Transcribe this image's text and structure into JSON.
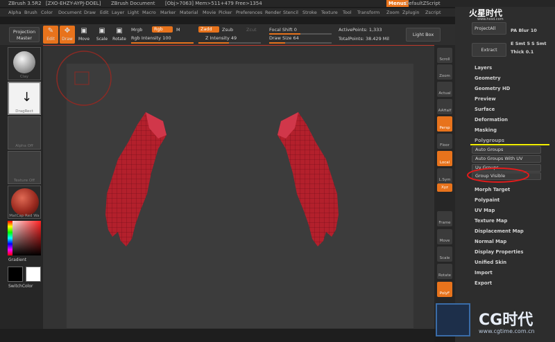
{
  "titlebar": {
    "app": "ZBrush 3.5R2",
    "session": "[ZXO-EHZY-AYPJ-DOEL]",
    "doc": "ZBrush Document",
    "stats": "[Obj>7063] Mem>511+479 Free>1354",
    "menus": "Menus",
    "script": "DefaultZScript"
  },
  "menubar": [
    "Alpha",
    "Brush",
    "Color",
    "Document",
    "Draw",
    "Edit",
    "Layer",
    "Light",
    "Macro",
    "Marker",
    "Material",
    "Movie",
    "Picker",
    "Preferences",
    "Render",
    "Stencil",
    "Stroke",
    "Texture",
    "Tool",
    "Transform",
    "Zoom",
    "Zplugin",
    "Zscript"
  ],
  "toolbar": {
    "projection_master": "Projection Master",
    "edit": "Edit",
    "draw": "Draw",
    "move": "Move",
    "scale": "Scale",
    "rotate": "Rotate",
    "mrgb": "Mrgb",
    "rgb": "Rgb",
    "m": "M",
    "zadd": "Zadd",
    "zsub": "Zsub",
    "zcut": "Zcut",
    "rgb_intensity": "Rgb Intensity 100",
    "z_intensity": "Z Intensity 49",
    "rgb_intensity_value": 1.0,
    "z_intensity_value": 0.49,
    "focal_shift": "Focal Shift 0",
    "draw_size": "Draw Size 64",
    "focal_shift_value": 0.5,
    "draw_size_value": 0.25,
    "active_points": "ActivePoints: 1,333",
    "total_points": "TotalPoints: 38.429 Mil",
    "light_box": "Light Box"
  },
  "leftshelf": {
    "clay": "Clay",
    "dragrect": "DragRect",
    "alpha_off": "Alpha Off",
    "texture_off": "Texture Off",
    "matcap": "MatCap Red Wa",
    "gradient": "Gradient",
    "switchcolor": "SwitchColor"
  },
  "rightshelf": [
    "Scroll",
    "Zoom",
    "Actual",
    "AAHalf",
    "Persp",
    "Floor",
    "Local",
    "L.Sym",
    "Xyz",
    "",
    "Frame",
    "Move",
    "Scale",
    "Rotate",
    "PolyF"
  ],
  "tray": {
    "project_all": "ProjectAll",
    "pa_blur": "PA Blur 10",
    "extract": "Extract",
    "e_smt": "E Smt 5",
    "s_smt": "S Smt",
    "thick": "Thick 0.1",
    "watermark_top": "火星时代",
    "watermark_url": "www.hxsd.com",
    "items": [
      "Layers",
      "Geometry",
      "Geometry HD",
      "Preview",
      "Surface",
      "Deformation",
      "Masking",
      "Polygroups"
    ],
    "polygroup_buttons": [
      "Auto Groups",
      "Auto Groups With UV",
      "Uv Groups",
      "Group Visible"
    ],
    "items2": [
      "Morph Target",
      "Polypaint",
      "UV Map",
      "Texture Map",
      "Displacement Map",
      "Normal Map",
      "Display Properties",
      "Unified Skin",
      "Import",
      "Export"
    ]
  },
  "watermark": {
    "brand": "CG时代",
    "url": "www.cgtime.com.cn"
  },
  "colors": {
    "accent": "#e8731c",
    "mesh": "#b3202c",
    "annotation_red": "#e21b1b",
    "annotation_yellow": "#f4f000"
  }
}
